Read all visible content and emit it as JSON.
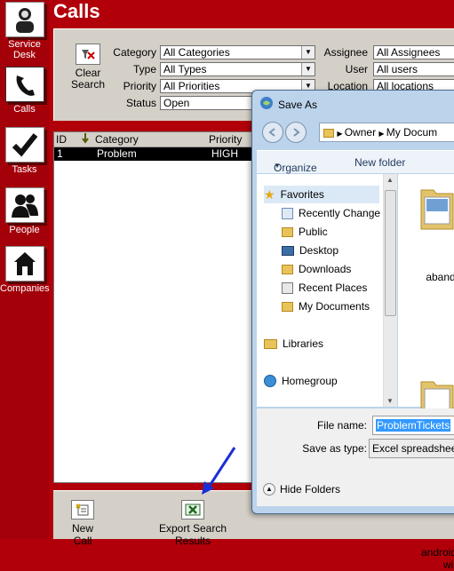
{
  "sidebar": {
    "items": [
      {
        "label": "Service Desk",
        "icon": "service-desk-icon"
      },
      {
        "label": "Calls",
        "icon": "phone-icon"
      },
      {
        "label": "Tasks",
        "icon": "checkmark-icon"
      },
      {
        "label": "People",
        "icon": "people-icon"
      },
      {
        "label": "Companies",
        "icon": "building-icon"
      }
    ]
  },
  "page": {
    "title": "Calls"
  },
  "filters": {
    "clear_label_1": "Clear",
    "clear_label_2": "Search",
    "category_label": "Category",
    "category_value": "All Categories",
    "type_label": "Type",
    "type_value": "All Types",
    "priority_label": "Priority",
    "priority_value": "All Priorities",
    "status_label": "Status",
    "status_value": "Open",
    "assignee_label": "Assignee",
    "assignee_value": "All Assignees",
    "user_label": "User",
    "user_value": "All users",
    "location_label": "Location",
    "location_value": "All locations"
  },
  "table": {
    "columns": [
      "ID",
      "Category",
      "Priority"
    ],
    "rows": [
      {
        "id": "1",
        "category": "Problem",
        "priority": "HIGH"
      }
    ]
  },
  "toolbar": {
    "new_call_label": "New Call",
    "export_label": "Export Search Results"
  },
  "dialog": {
    "title": "Save As",
    "address": [
      "Owner",
      "My Docum"
    ],
    "organize_label": "Organize",
    "new_folder_label": "New folder",
    "nav": {
      "favorites": "Favorites",
      "recently_changed": "Recently Change",
      "public": "Public",
      "desktop": "Desktop",
      "downloads": "Downloads",
      "recent_places": "Recent Places",
      "my_documents": "My Documents",
      "libraries": "Libraries",
      "homegroup": "Homegroup"
    },
    "files": [
      {
        "name": "aband"
      },
      {
        "name_line1": "android",
        "name_line2": "win"
      }
    ],
    "file_name_label": "File name:",
    "file_name_value": "ProblemTickets",
    "save_type_label": "Save as type:",
    "save_type_value": "Excel spreadsheet",
    "hide_folders_label": "Hide Folders"
  },
  "colors": {
    "brand_red": "#b2000b",
    "selection_blue": "#3399ff",
    "annotation_arrow": "#1a2fd6"
  }
}
